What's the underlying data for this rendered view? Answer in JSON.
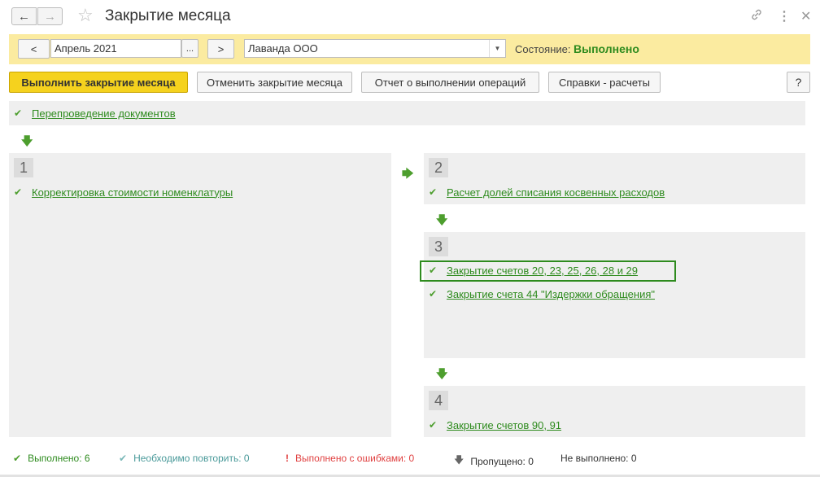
{
  "window": {
    "title": "Закрытие месяца",
    "back_icon": "arrow-left-icon",
    "forward_icon": "arrow-right-icon",
    "favorite_icon": "star-icon",
    "link_icon": "link-icon",
    "more_icon": "more-vertical-icon",
    "close_icon": "close-icon"
  },
  "period_bar": {
    "prev_label": "<",
    "period_value": "Апрель 2021",
    "select_label": "...",
    "next_label": ">",
    "org_value": "Лаванда ООО",
    "state_label": "Состояние:",
    "state_value": "Выполнено"
  },
  "toolbar": {
    "run_label": "Выполнить закрытие месяца",
    "cancel_label": "Отменить закрытие месяца",
    "report_label": "Отчет о выполнении операций",
    "help_calc_label": "Справки - расчеты",
    "help_label": "?"
  },
  "steps": {
    "repost": "Перепроведение документов",
    "stage1_num": "1",
    "stage1_items": [
      "Корректировка стоимости номенклатуры"
    ],
    "stage2_num": "2",
    "stage2_items": [
      "Расчет долей списания косвенных расходов"
    ],
    "stage3_num": "3",
    "stage3_items": [
      "Закрытие счетов 20, 23, 25, 26, 28 и 29",
      "Закрытие счета 44 \"Издержки обращения\""
    ],
    "stage4_num": "4",
    "stage4_items": [
      "Закрытие счетов 90, 91"
    ]
  },
  "legend": {
    "done_label": "Выполнено:",
    "done_count": "6",
    "repeat_label": "Необходимо повторить:",
    "repeat_count": "0",
    "errors_label": "Выполнено с ошибками:",
    "errors_count": "0",
    "skipped_label": "Пропущено:",
    "skipped_count": "0",
    "not_done_label": "Не выполнено:",
    "not_done_count": "0"
  },
  "colors": {
    "accent_green": "#2e8b1e",
    "period_bar_bg": "#fbeba0",
    "main_button": "#f5d21e",
    "error_red": "#e04040",
    "repeat_teal": "#4a9a9a"
  }
}
